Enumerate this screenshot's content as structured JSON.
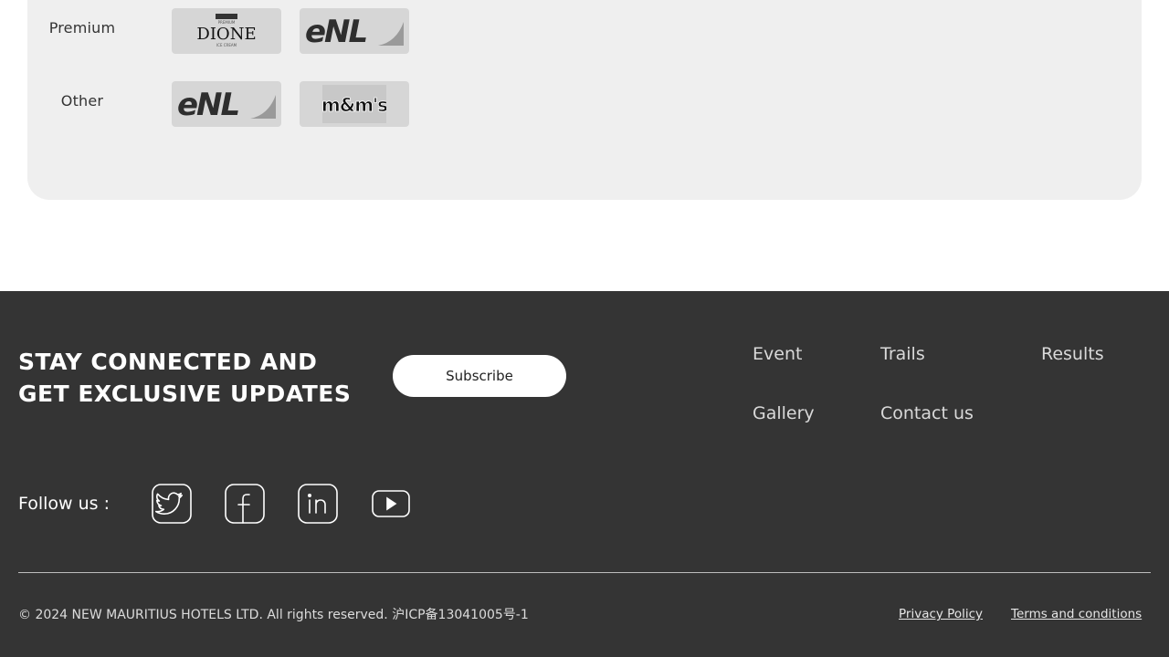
{
  "sponsors": {
    "tiers": [
      {
        "label": "Premium",
        "logos": [
          {
            "name": "DIONE",
            "icon": "dione-logo",
            "caption_top": "PREMIUM",
            "caption_bottom": "ICE CREAM"
          },
          {
            "name": "eNL",
            "icon": "enl-logo"
          }
        ]
      },
      {
        "label": "Other",
        "logos": [
          {
            "name": "eNL",
            "icon": "enl-logo"
          },
          {
            "name": "m&m's",
            "icon": "mms-logo"
          }
        ]
      }
    ]
  },
  "footer": {
    "headline_line1": "STAY CONNECTED AND",
    "headline_line2": "GET EXCLUSIVE UPDATES",
    "subscribe_label": "Subscribe",
    "nav": {
      "event": "Event",
      "trails": "Trails",
      "results": "Results",
      "gallery": "Gallery",
      "contact": "Contact us"
    },
    "follow_label": "Follow us :",
    "social": [
      "twitter-icon",
      "facebook-icon",
      "linkedin-icon",
      "youtube-icon"
    ],
    "copyright": "© 2024 NEW MAURITIUS HOTELS LTD. All rights reserved. 沪ICP备13041005号-1",
    "privacy": "Privacy Policy",
    "terms": "Terms and conditions"
  },
  "colors": {
    "panel": "#efefef",
    "footer_bg": "#343434",
    "logo_card": "#d6d6d6"
  }
}
